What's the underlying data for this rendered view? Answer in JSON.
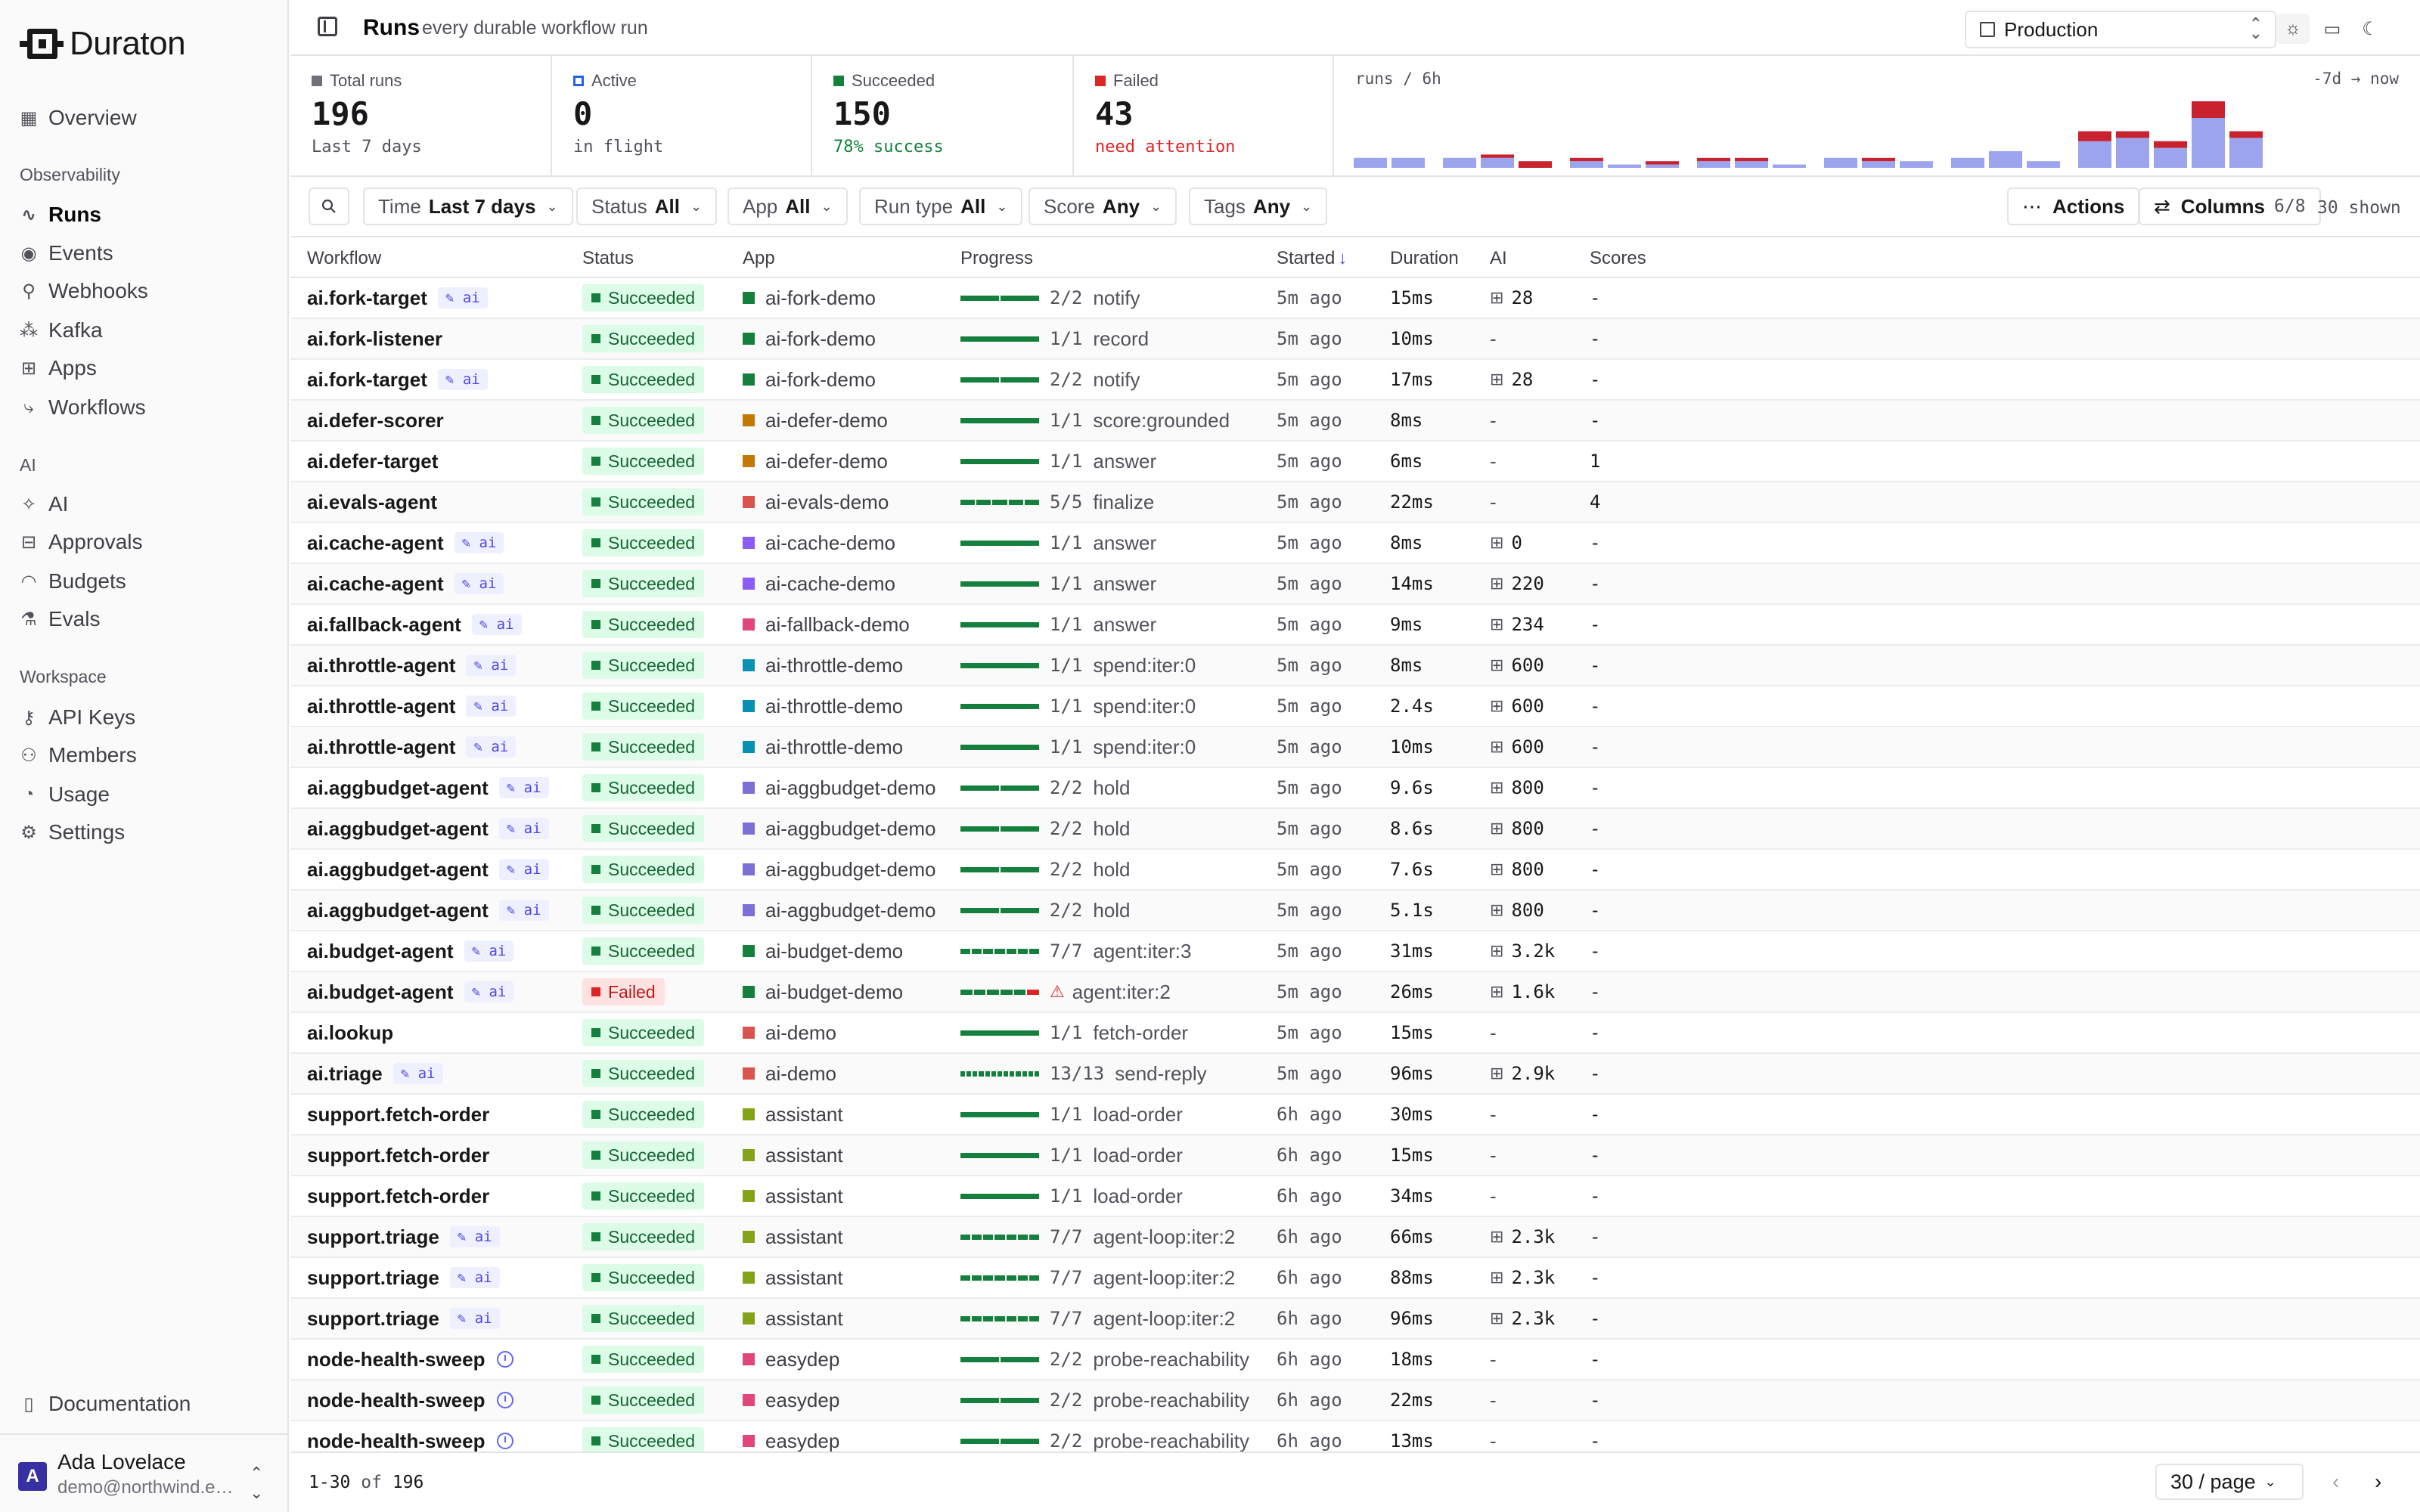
{
  "brand": {
    "name": "Duraton"
  },
  "sidebar": {
    "overview": "Overview",
    "sections": [
      {
        "title": "Observability",
        "items": [
          {
            "label": "Runs",
            "icon": "activity-icon",
            "active": true
          },
          {
            "label": "Events",
            "icon": "radio-icon"
          },
          {
            "label": "Webhooks",
            "icon": "webhook-icon"
          },
          {
            "label": "Kafka",
            "icon": "kafka-icon"
          },
          {
            "label": "Apps",
            "icon": "boxes-icon"
          },
          {
            "label": "Workflows",
            "icon": "workflow-icon"
          }
        ]
      },
      {
        "title": "AI",
        "items": [
          {
            "label": "AI",
            "icon": "sparkles-icon"
          },
          {
            "label": "Approvals",
            "icon": "inbox-icon"
          },
          {
            "label": "Budgets",
            "icon": "gauge-icon"
          },
          {
            "label": "Evals",
            "icon": "flask-icon"
          }
        ]
      },
      {
        "title": "Workspace",
        "items": [
          {
            "label": "API Keys",
            "icon": "key-icon"
          },
          {
            "label": "Members",
            "icon": "users-icon"
          },
          {
            "label": "Usage",
            "icon": "usage-icon"
          },
          {
            "label": "Settings",
            "icon": "gear-icon"
          }
        ]
      }
    ],
    "documentation": "Documentation",
    "user": {
      "initial": "A",
      "name": "Ada Lovelace",
      "email": "demo@northwind.ex..."
    }
  },
  "header": {
    "title": "Runs",
    "subtitle": "every durable workflow run",
    "environment": "Production"
  },
  "stats": [
    {
      "label": "Total runs",
      "value": "196",
      "sub": "Last 7 days",
      "color": "#71717a",
      "subColor": "#52525b"
    },
    {
      "label": "Active",
      "value": "0",
      "sub": "in flight",
      "color": "#2563eb",
      "subColor": "#52525b"
    },
    {
      "label": "Succeeded",
      "value": "150",
      "sub": "78% success",
      "color": "#15803d",
      "subColor": "#15803d"
    },
    {
      "label": "Failed",
      "value": "43",
      "sub": "need attention",
      "color": "#dc2626",
      "subColor": "#dc2626"
    }
  ],
  "sparkline": {
    "title": "runs / 6h",
    "range": "-7d → now",
    "colors": {
      "success": "#9da4ee",
      "failed": "#c8222f"
    },
    "buckets": [
      [
        3,
        0
      ],
      [
        3,
        0
      ],
      null,
      [
        3,
        0
      ],
      [
        3,
        1
      ],
      [
        0,
        2
      ],
      null,
      [
        2,
        1
      ],
      [
        1,
        0
      ],
      [
        1,
        1
      ],
      null,
      [
        2,
        1
      ],
      [
        2,
        1
      ],
      [
        1,
        0
      ],
      null,
      [
        3,
        0
      ],
      [
        2,
        1
      ],
      [
        2,
        0
      ],
      null,
      [
        3,
        0
      ],
      [
        5,
        0
      ],
      [
        2,
        0
      ],
      null,
      [
        8,
        3
      ],
      [
        9,
        2
      ],
      [
        6,
        2
      ],
      [
        15,
        5
      ],
      [
        9,
        2
      ]
    ]
  },
  "filters": {
    "items": [
      {
        "label": "Time",
        "value": "Last 7 days"
      },
      {
        "label": "Status",
        "value": "All"
      },
      {
        "label": "App",
        "value": "All"
      },
      {
        "label": "Run type",
        "value": "All"
      },
      {
        "label": "Score",
        "value": "Any"
      },
      {
        "label": "Tags",
        "value": "Any"
      }
    ],
    "actions": "Actions",
    "columns": "Columns",
    "columns_count": "6/8",
    "shown": "30 shown"
  },
  "table": {
    "headers": [
      "Workflow",
      "Status",
      "App",
      "Progress",
      "Started",
      "Duration",
      "AI",
      "Scores"
    ],
    "rows": [
      {
        "wf": "ai.fork-target",
        "tag": "ai",
        "status": "Succeeded",
        "app": "ai-fork-demo",
        "appColor": "#15803d",
        "done": 2,
        "total": 2,
        "prog": "2/2",
        "step": "notify",
        "started": "5m ago",
        "duration": "15ms",
        "ai": "28",
        "score": "-"
      },
      {
        "wf": "ai.fork-listener",
        "tag": "",
        "status": "Succeeded",
        "app": "ai-fork-demo",
        "appColor": "#15803d",
        "done": 1,
        "total": 1,
        "prog": "1/1",
        "step": "record",
        "started": "5m ago",
        "duration": "10ms",
        "ai": "-",
        "score": "-"
      },
      {
        "wf": "ai.fork-target",
        "tag": "ai",
        "status": "Succeeded",
        "app": "ai-fork-demo",
        "appColor": "#15803d",
        "done": 2,
        "total": 2,
        "prog": "2/2",
        "step": "notify",
        "started": "5m ago",
        "duration": "17ms",
        "ai": "28",
        "score": "-"
      },
      {
        "wf": "ai.defer-scorer",
        "tag": "",
        "status": "Succeeded",
        "app": "ai-defer-demo",
        "appColor": "#c27803",
        "done": 1,
        "total": 1,
        "prog": "1/1",
        "step": "score:grounded",
        "started": "5m ago",
        "duration": "8ms",
        "ai": "-",
        "score": "-"
      },
      {
        "wf": "ai.defer-target",
        "tag": "",
        "status": "Succeeded",
        "app": "ai-defer-demo",
        "appColor": "#c27803",
        "done": 1,
        "total": 1,
        "prog": "1/1",
        "step": "answer",
        "started": "5m ago",
        "duration": "6ms",
        "ai": "-",
        "score": "1"
      },
      {
        "wf": "ai.evals-agent",
        "tag": "",
        "status": "Succeeded",
        "app": "ai-evals-demo",
        "appColor": "#d9534f",
        "done": 5,
        "total": 5,
        "prog": "5/5",
        "step": "finalize",
        "started": "5m ago",
        "duration": "22ms",
        "ai": "-",
        "score": "4"
      },
      {
        "wf": "ai.cache-agent",
        "tag": "ai",
        "status": "Succeeded",
        "app": "ai-cache-demo",
        "appColor": "#8b5cf6",
        "done": 1,
        "total": 1,
        "prog": "1/1",
        "step": "answer",
        "started": "5m ago",
        "duration": "8ms",
        "ai": "0",
        "score": "-"
      },
      {
        "wf": "ai.cache-agent",
        "tag": "ai",
        "status": "Succeeded",
        "app": "ai-cache-demo",
        "appColor": "#8b5cf6",
        "done": 1,
        "total": 1,
        "prog": "1/1",
        "step": "answer",
        "started": "5m ago",
        "duration": "14ms",
        "ai": "220",
        "score": "-"
      },
      {
        "wf": "ai.fallback-agent",
        "tag": "ai",
        "status": "Succeeded",
        "app": "ai-fallback-demo",
        "appColor": "#e0457b",
        "done": 1,
        "total": 1,
        "prog": "1/1",
        "step": "answer",
        "started": "5m ago",
        "duration": "9ms",
        "ai": "234",
        "score": "-"
      },
      {
        "wf": "ai.throttle-agent",
        "tag": "ai",
        "status": "Succeeded",
        "app": "ai-throttle-demo",
        "appColor": "#0891b2",
        "done": 1,
        "total": 1,
        "prog": "1/1",
        "step": "spend:iter:0",
        "started": "5m ago",
        "duration": "8ms",
        "ai": "600",
        "score": "-"
      },
      {
        "wf": "ai.throttle-agent",
        "tag": "ai",
        "status": "Succeeded",
        "app": "ai-throttle-demo",
        "appColor": "#0891b2",
        "done": 1,
        "total": 1,
        "prog": "1/1",
        "step": "spend:iter:0",
        "started": "5m ago",
        "duration": "2.4s",
        "ai": "600",
        "score": "-"
      },
      {
        "wf": "ai.throttle-agent",
        "tag": "ai",
        "status": "Succeeded",
        "app": "ai-throttle-demo",
        "appColor": "#0891b2",
        "done": 1,
        "total": 1,
        "prog": "1/1",
        "step": "spend:iter:0",
        "started": "5m ago",
        "duration": "10ms",
        "ai": "600",
        "score": "-"
      },
      {
        "wf": "ai.aggbudget-agent",
        "tag": "ai",
        "status": "Succeeded",
        "app": "ai-aggbudget-demo",
        "appColor": "#7c6fd6",
        "done": 2,
        "total": 2,
        "prog": "2/2",
        "step": "hold",
        "started": "5m ago",
        "duration": "9.6s",
        "ai": "800",
        "score": "-"
      },
      {
        "wf": "ai.aggbudget-agent",
        "tag": "ai",
        "status": "Succeeded",
        "app": "ai-aggbudget-demo",
        "appColor": "#7c6fd6",
        "done": 2,
        "total": 2,
        "prog": "2/2",
        "step": "hold",
        "started": "5m ago",
        "duration": "8.6s",
        "ai": "800",
        "score": "-"
      },
      {
        "wf": "ai.aggbudget-agent",
        "tag": "ai",
        "status": "Succeeded",
        "app": "ai-aggbudget-demo",
        "appColor": "#7c6fd6",
        "done": 2,
        "total": 2,
        "prog": "2/2",
        "step": "hold",
        "started": "5m ago",
        "duration": "7.6s",
        "ai": "800",
        "score": "-"
      },
      {
        "wf": "ai.aggbudget-agent",
        "tag": "ai",
        "status": "Succeeded",
        "app": "ai-aggbudget-demo",
        "appColor": "#7c6fd6",
        "done": 2,
        "total": 2,
        "prog": "2/2",
        "step": "hold",
        "started": "5m ago",
        "duration": "5.1s",
        "ai": "800",
        "score": "-"
      },
      {
        "wf": "ai.budget-agent",
        "tag": "ai",
        "status": "Succeeded",
        "app": "ai-budget-demo",
        "appColor": "#15803d",
        "done": 7,
        "total": 7,
        "prog": "7/7",
        "step": "agent:iter:3",
        "started": "5m ago",
        "duration": "31ms",
        "ai": "3.2k",
        "score": "-"
      },
      {
        "wf": "ai.budget-agent",
        "tag": "ai",
        "status": "Failed",
        "app": "ai-budget-demo",
        "appColor": "#15803d",
        "done": 5,
        "total": 6,
        "prog": "",
        "step": "agent:iter:2",
        "started": "5m ago",
        "duration": "26ms",
        "ai": "1.6k",
        "score": "-",
        "warn": true
      },
      {
        "wf": "ai.lookup",
        "tag": "",
        "status": "Succeeded",
        "app": "ai-demo",
        "appColor": "#d9534f",
        "done": 1,
        "total": 1,
        "prog": "1/1",
        "step": "fetch-order",
        "started": "5m ago",
        "duration": "15ms",
        "ai": "-",
        "score": "-"
      },
      {
        "wf": "ai.triage",
        "tag": "ai",
        "status": "Succeeded",
        "app": "ai-demo",
        "appColor": "#d9534f",
        "done": 13,
        "total": 13,
        "prog": "13/13",
        "step": "send-reply",
        "started": "5m ago",
        "duration": "96ms",
        "ai": "2.9k",
        "score": "-"
      },
      {
        "wf": "support.fetch-order",
        "tag": "",
        "status": "Succeeded",
        "app": "assistant",
        "appColor": "#84a31a",
        "done": 1,
        "total": 1,
        "prog": "1/1",
        "step": "load-order",
        "started": "6h ago",
        "duration": "30ms",
        "ai": "-",
        "score": "-"
      },
      {
        "wf": "support.fetch-order",
        "tag": "",
        "status": "Succeeded",
        "app": "assistant",
        "appColor": "#84a31a",
        "done": 1,
        "total": 1,
        "prog": "1/1",
        "step": "load-order",
        "started": "6h ago",
        "duration": "15ms",
        "ai": "-",
        "score": "-"
      },
      {
        "wf": "support.fetch-order",
        "tag": "",
        "status": "Succeeded",
        "app": "assistant",
        "appColor": "#84a31a",
        "done": 1,
        "total": 1,
        "prog": "1/1",
        "step": "load-order",
        "started": "6h ago",
        "duration": "34ms",
        "ai": "-",
        "score": "-"
      },
      {
        "wf": "support.triage",
        "tag": "ai",
        "status": "Succeeded",
        "app": "assistant",
        "appColor": "#84a31a",
        "done": 7,
        "total": 7,
        "prog": "7/7",
        "step": "agent-loop:iter:2",
        "started": "6h ago",
        "duration": "66ms",
        "ai": "2.3k",
        "score": "-"
      },
      {
        "wf": "support.triage",
        "tag": "ai",
        "status": "Succeeded",
        "app": "assistant",
        "appColor": "#84a31a",
        "done": 7,
        "total": 7,
        "prog": "7/7",
        "step": "agent-loop:iter:2",
        "started": "6h ago",
        "duration": "88ms",
        "ai": "2.3k",
        "score": "-"
      },
      {
        "wf": "support.triage",
        "tag": "ai",
        "status": "Succeeded",
        "app": "assistant",
        "appColor": "#84a31a",
        "done": 7,
        "total": 7,
        "prog": "7/7",
        "step": "agent-loop:iter:2",
        "started": "6h ago",
        "duration": "96ms",
        "ai": "2.3k",
        "score": "-"
      },
      {
        "wf": "node-health-sweep",
        "tag": "clock",
        "status": "Succeeded",
        "app": "easydep",
        "appColor": "#e0457b",
        "done": 2,
        "total": 2,
        "prog": "2/2",
        "step": "probe-reachability",
        "started": "6h ago",
        "duration": "18ms",
        "ai": "-",
        "score": "-"
      },
      {
        "wf": "node-health-sweep",
        "tag": "clock",
        "status": "Succeeded",
        "app": "easydep",
        "appColor": "#e0457b",
        "done": 2,
        "total": 2,
        "prog": "2/2",
        "step": "probe-reachability",
        "started": "6h ago",
        "duration": "22ms",
        "ai": "-",
        "score": "-"
      },
      {
        "wf": "node-health-sweep",
        "tag": "clock",
        "status": "Succeeded",
        "app": "easydep",
        "appColor": "#e0457b",
        "done": 2,
        "total": 2,
        "prog": "2/2",
        "step": "probe-reachability",
        "started": "6h ago",
        "duration": "13ms",
        "ai": "-",
        "score": "-"
      }
    ]
  },
  "footer": {
    "range": "1-30",
    "of": "of",
    "total": "196",
    "per_page": "30 / page"
  }
}
